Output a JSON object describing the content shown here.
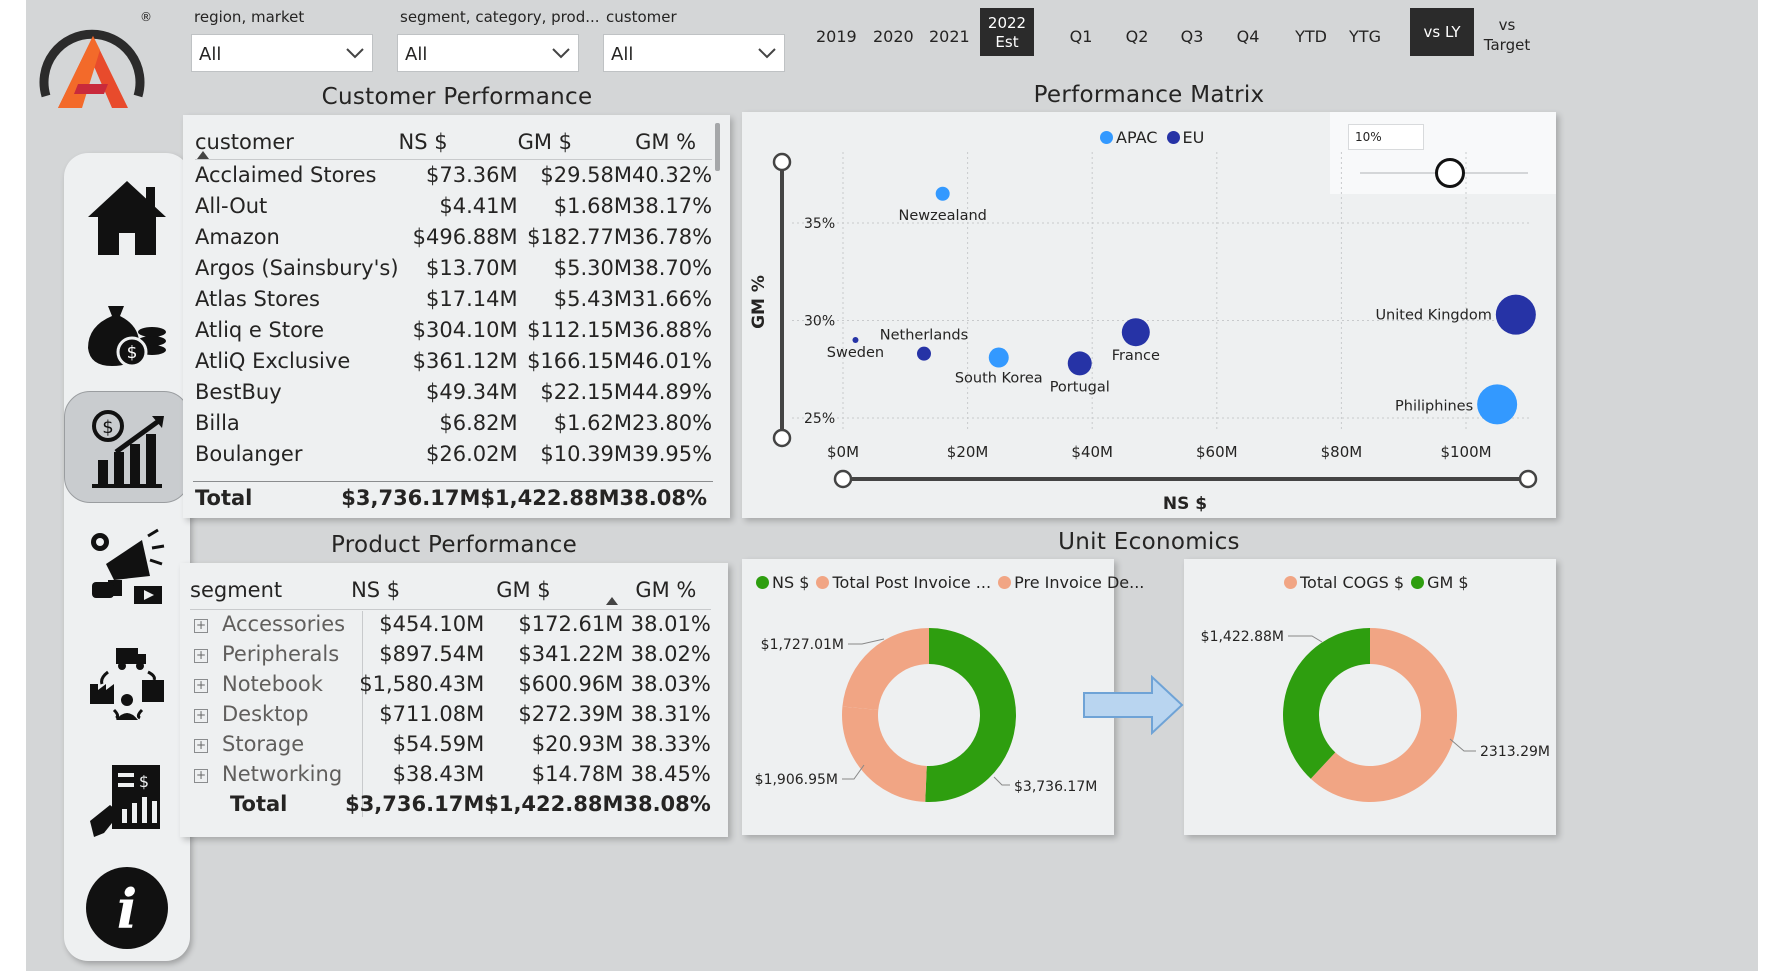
{
  "filters": {
    "region": {
      "label": "region, market",
      "value": "All"
    },
    "segment": {
      "label": "segment, category, prod...",
      "value": "All"
    },
    "customer": {
      "label": "customer",
      "value": "All"
    }
  },
  "years": [
    "2019",
    "2020",
    "2021",
    "2022",
    "Est"
  ],
  "quarters": [
    "Q1",
    "Q2",
    "Q3",
    "Q4",
    "YTD",
    "YTG"
  ],
  "compare": {
    "selected": "vs LY",
    "other_line1": "vs",
    "other_line2": "Target"
  },
  "nav_icons": [
    "home-icon",
    "money-bag-icon",
    "finance-chart-icon",
    "marketing-icon",
    "supply-chain-icon",
    "report-icon",
    "info-icon"
  ],
  "customer_performance": {
    "title": "Customer Performance",
    "columns": [
      "customer",
      "NS $",
      "GM $",
      "GM %"
    ],
    "rows": [
      [
        "Acclaimed Stores",
        "$73.36M",
        "$29.58M",
        "40.32%"
      ],
      [
        "All-Out",
        "$4.41M",
        "$1.68M",
        "38.17%"
      ],
      [
        "Amazon",
        "$496.88M",
        "$182.77M",
        "36.78%"
      ],
      [
        "Argos (Sainsbury's)",
        "$13.70M",
        "$5.30M",
        "38.70%"
      ],
      [
        "Atlas Stores",
        "$17.14M",
        "$5.43M",
        "31.66%"
      ],
      [
        "Atliq e Store",
        "$304.10M",
        "$112.15M",
        "36.88%"
      ],
      [
        "AtliQ Exclusive",
        "$361.12M",
        "$166.15M",
        "46.01%"
      ],
      [
        "BestBuy",
        "$49.34M",
        "$22.15M",
        "44.89%"
      ],
      [
        "Billa",
        "$6.82M",
        "$1.62M",
        "23.80%"
      ],
      [
        "Boulanger",
        "$26.02M",
        "$10.39M",
        "39.95%"
      ]
    ],
    "total": [
      "Total",
      "$3,736.17M",
      "$1,422.88M",
      "38.08%"
    ]
  },
  "product_performance": {
    "title": "Product Performance",
    "columns": [
      "segment",
      "NS $",
      "GM $",
      "GM %"
    ],
    "rows": [
      [
        "Accessories",
        "$454.10M",
        "$172.61M",
        "38.01%"
      ],
      [
        "Peripherals",
        "$897.54M",
        "$341.22M",
        "38.02%"
      ],
      [
        "Notebook",
        "$1,580.43M",
        "$600.96M",
        "38.03%"
      ],
      [
        "Desktop",
        "$711.08M",
        "$272.39M",
        "38.31%"
      ],
      [
        "Storage",
        "$54.59M",
        "$20.93M",
        "38.33%"
      ],
      [
        "Networking",
        "$38.43M",
        "$14.78M",
        "38.45%"
      ]
    ],
    "total": [
      "Total",
      "$3,736.17M",
      "$1,422.88M",
      "38.08%"
    ]
  },
  "performance_matrix": {
    "title": "Performance Matrix",
    "slider_value": "10%",
    "chart_data": {
      "type": "scatter",
      "xlabel": "NS $",
      "ylabel": "GM %",
      "xticks": [
        "$0M",
        "$20M",
        "$40M",
        "$60M",
        "$80M",
        "$100M"
      ],
      "yticks": [
        "35%",
        "30%",
        "25%"
      ],
      "xlim": [
        0,
        100
      ],
      "ylim": [
        25,
        35
      ],
      "legend": [
        {
          "name": "APAC",
          "color": "#3399ff"
        },
        {
          "name": "EU",
          "color": "#2633a6"
        }
      ],
      "points": [
        {
          "label": "Newzealand",
          "x": 16,
          "y": 36.5,
          "size": 7,
          "group": "APAC"
        },
        {
          "label": "Sweden",
          "x": 2,
          "y": 29,
          "size": 3,
          "group": "EU"
        },
        {
          "label": "Netherlands",
          "x": 13,
          "y": 28.3,
          "size": 7,
          "group": "EU"
        },
        {
          "label": "South Korea",
          "x": 25,
          "y": 28.1,
          "size": 10,
          "group": "APAC"
        },
        {
          "label": "Portugal",
          "x": 38,
          "y": 27.8,
          "size": 12,
          "group": "EU"
        },
        {
          "label": "France",
          "x": 47,
          "y": 29.4,
          "size": 14,
          "group": "EU"
        },
        {
          "label": "United Kingdom",
          "x": 108,
          "y": 30.3,
          "size": 20,
          "group": "EU"
        },
        {
          "label": "Philiphines",
          "x": 105,
          "y": 25.7,
          "size": 20,
          "group": "APAC"
        }
      ]
    }
  },
  "unit_economics": {
    "title": "Unit Economics",
    "chart_data": [
      {
        "type": "pie",
        "legend": [
          "NS $",
          "Total Post Invoice ...",
          "Pre Invoice De..."
        ],
        "slices": [
          {
            "name": "NS $",
            "value": 3736.17,
            "label": "$3,736.17M",
            "color": "#2e9e0f"
          },
          {
            "name": "Total Post Invoice",
            "value": 1906.95,
            "label": "$1,906.95M",
            "color": "#f1a584"
          },
          {
            "name": "Pre Invoice Deductions",
            "value": 1727.01,
            "label": "$1,727.01M",
            "color": "#f1a584"
          }
        ]
      },
      {
        "type": "pie",
        "legend": [
          "Total COGS $",
          "GM $"
        ],
        "slices": [
          {
            "name": "Total COGS $",
            "value": 2313.29,
            "label": "2313.29M",
            "color": "#f1a584"
          },
          {
            "name": "GM $",
            "value": 1422.88,
            "label": "$1,422.88M",
            "color": "#2e9e0f"
          }
        ]
      }
    ]
  }
}
